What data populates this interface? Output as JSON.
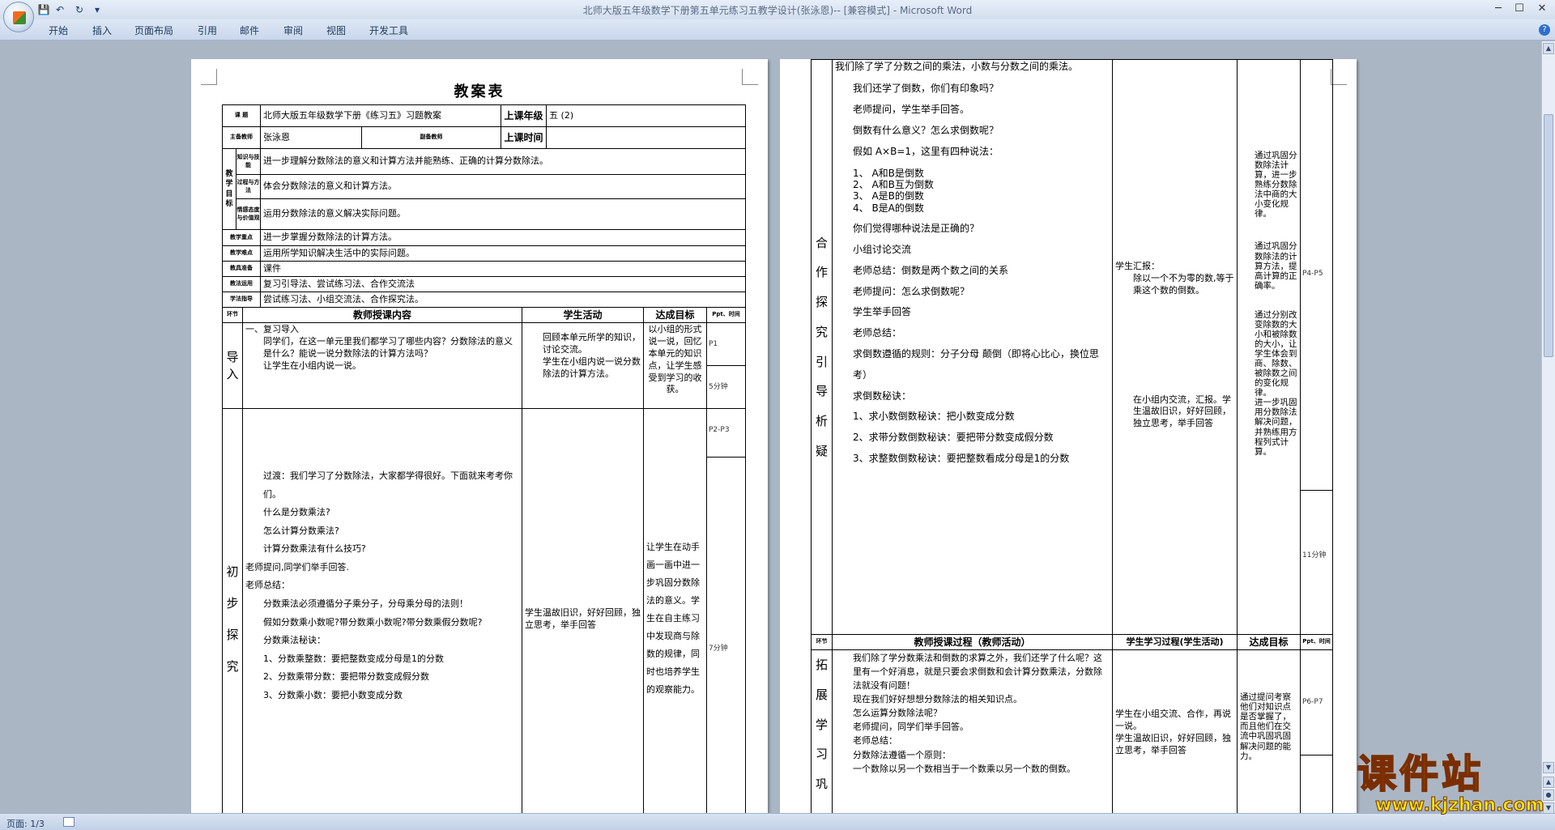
{
  "window": {
    "title": "北师大版五年级数学下册第五单元练习五教学设计(张泳恩)-- [兼容模式] - Microsoft Word",
    "controls": {
      "minimize": "─",
      "maximize": "☐",
      "close": "✕"
    },
    "quick_access": {
      "save": "💾",
      "undo": "↶",
      "redo": "↻",
      "customize": "▾"
    }
  },
  "ribbon": {
    "tabs": [
      "开始",
      "插入",
      "页面布局",
      "引用",
      "邮件",
      "审阅",
      "视图",
      "开发工具"
    ],
    "help": "?"
  },
  "status_bar": {
    "page_info": "页面: 1/3"
  },
  "watermark": {
    "text": "课件站",
    "url": "www.kjzhan.com"
  },
  "page1": {
    "title": "教案表",
    "info": {
      "topic_label": "课  题",
      "topic_value": "北师大版五年级数学下册《练习五》习题教案",
      "grade_label": "上课年级",
      "grade_value": "五 (2)",
      "teacher_label": "主备教师",
      "teacher_value": "张泳恩",
      "assist_label": "副备教师",
      "time_label": "上课时间",
      "goals_label": "教 学 目 标",
      "goal1_label": "知识与技能",
      "goal1_text": "进一步理解分数除法的意义和计算方法并能熟练、正确的计算分数除法。",
      "goal2_label": "过程与方法",
      "goal2_text": "体会分数除法的意义和计算方法。",
      "goal3_label": "情感态度与价值观",
      "goal3_text": "运用分数除法的意义解决实际问题。",
      "key_label": "教学重点",
      "key_text": "进一步掌握分数除法的计算方法。",
      "diff_label": "教学难点",
      "diff_text": "运用所学知识解决生活中的实际问题。",
      "prep_label": "教具准备",
      "prep_text": "课件",
      "method_label": "教法运用",
      "method_text": "复习引导法、尝试练习法、合作交流法",
      "learn_label": "学法指导",
      "learn_text": "尝试练习法、小组交流法、合作探究法。"
    },
    "columns": {
      "stage": "环节",
      "content": "教师授课内容",
      "activity": "学生活动",
      "goal": "达成目标",
      "time": "Ppt、时间"
    },
    "rows": [
      {
        "stage": "导入",
        "content": [
          "一、复习导入",
          "同学们，在这一单元里我们都学习了哪些内容？分数除法的意义是什么？能说一说分数除法的计算方法吗？",
          "让学生在小组内说一说。"
        ],
        "activity": [
          "回顾本单元所学的知识，讨论交流。",
          "学生在小组内说一说分数除法的计算方法。"
        ],
        "goal": "以小组的形式说一说，回忆本单元的知识点，让学生感受到学习的收获。",
        "ppt": "P1",
        "time": "5分钟"
      },
      {
        "stage": "初步探究",
        "content": [
          "过渡：我们学习了分数除法，大家都学得很好。下面就来考考你们。",
          "什么是分数乘法?",
          "怎么计算分数乘法?",
          "计算分数乘法有什么技巧?",
          "老师提问,同学们举手回答.",
          "老师总结：",
          "分数乘法必须遵循分子乘分子，分母乘分母的法则！",
          "假如分数乘小数呢?带分数乘小数呢?带分数乘假分数呢?",
          "分数乘法秘诀：",
          "1、分数乘整数：要把整数变成分母是1的分数",
          "2、分数乘带分数：要把带分数变成假分数",
          "3、分数乘小数：要把小数变成分数"
        ],
        "activity": [
          "学生温故旧识，好好回顾，独立思考，举手回答"
        ],
        "goal": "让学生在动手画一画中进一步巩固分数除法的意义。学生在自主练习中发现商与除数的规律，同时也培养学生的观察能力。",
        "ppt": "P2-P3",
        "time": "7分钟"
      }
    ]
  },
  "page2": {
    "row1": {
      "stage": "合作探究引导析疑",
      "content": [
        "我们除了学了分数之间的乘法，小数与分数之间的乘法。",
        "我们还学了倒数，你们有印象吗？",
        "老师提问，学生举手回答。",
        "倒数有什么意义？怎么求倒数呢？",
        "假如 A×B=1，这里有四种说法：",
        "1、 A和B是倒数",
        "2、 A和B互为倒数",
        "3、 A是B的倒数",
        "4、 B是A的倒数",
        "你们觉得哪种说法是正确的？",
        "小组讨论交流",
        "老师总结：倒数是两个数之间的关系",
        "老师提问：怎么求倒数呢？",
        "学生举手回答",
        "老师总结：",
        "求倒数遵循的规则：分子分母 颠倒（即将心比心，换位思考）",
        "求倒数秘诀：",
        "1、求小数倒数秘诀：把小数变成分数",
        "2、求带分数倒数秘诀：要把带分数变成假分数",
        "3、求整数倒数秘诀：要把整数看成分母是1的分数"
      ],
      "activity": [
        "学生汇报：",
        "除以一个不为零的数,等于乘这个数的倒数。",
        "在小组内交流，汇报。学生温故旧识，好好回顾，独立思考，举手回答"
      ],
      "goal": [
        "通过巩固分数除法计算，进一步熟练分数除法中商的大小变化规律。",
        "通过巩固分数除法的计算方法，提高计算的正确率。",
        "通过分别改变除数的大小和被除数的大小，让学生体会到商、除数、被除数之间的变化规律。",
        "进一步巩固用分数除法解决问题，并熟练用方程列式计算。"
      ],
      "ppt": "P4-P5",
      "time": "11分钟"
    },
    "columns": {
      "stage": "环节",
      "content": "教师授课过程（教师活动）",
      "activity": "学生学习过程(学生活动)",
      "goal": "达成目标",
      "time": "Ppt、时间"
    },
    "row2": {
      "stage": "拓展学习巩",
      "content": [
        "我们除了学分数乘法和倒数的求算之外，我们还学了什么呢？这里有一个好消息，就是只要会求倒数和会计算分数乘法，分数除法就没有问题！",
        "现在我们好好想想分数除法的相关知识点。",
        "怎么运算分数除法呢？",
        "老师提问，同学们举手回答。",
        "老师总结：",
        "分数除法遵循一个原则：",
        "一个数除以另一个数相当于一个数乘以另一个数的倒数。"
      ],
      "activity": [
        "学生在小组交流、合作，再说一说。",
        "学生温故旧识，好好回顾，独立思考，举手回答"
      ],
      "goal": "通过提问考察他们对知识点是否掌握了，而且他们在交流中巩固巩固解决问题的能力。",
      "ppt": "P6-P7"
    }
  }
}
